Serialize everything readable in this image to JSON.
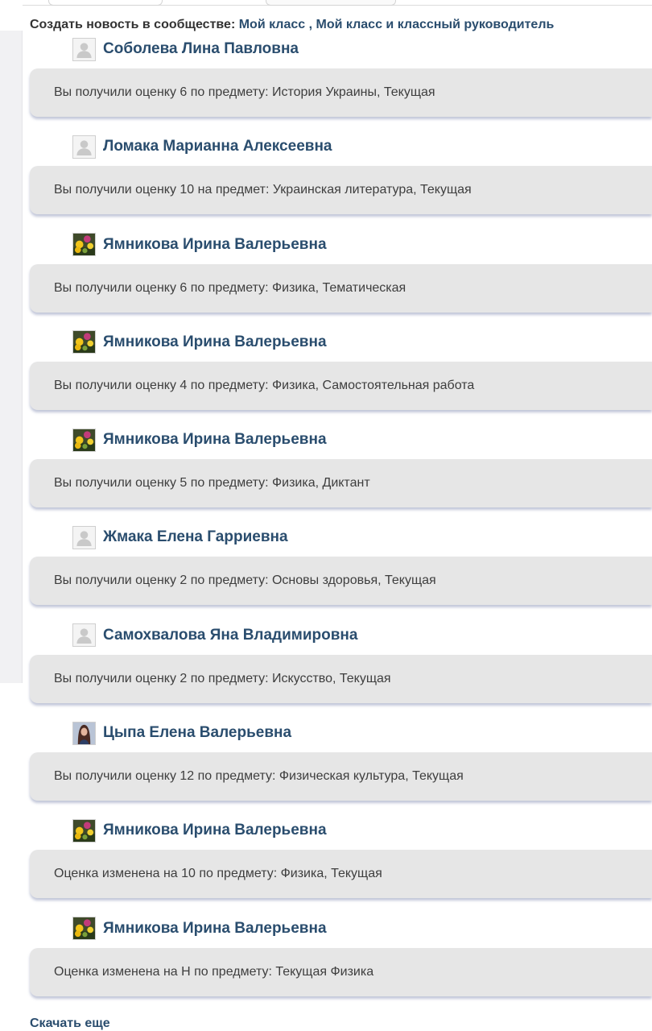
{
  "create_news": {
    "label": "Создать новость в сообществе:",
    "link1": "Мой класс",
    "separator": ",",
    "link2": "Мой класс и классный руководитель"
  },
  "feed": [
    {
      "author": "Соболева Лина Павловна",
      "avatar": "default-user-icon",
      "message": "Вы получили оценку 6 по предмету: История Украины, Текущая"
    },
    {
      "author": "Ломака Марианна Алексеевна",
      "avatar": "default-user-icon",
      "message": "Вы получили оценку 10 на предмет: Украинская литература, Текущая"
    },
    {
      "author": "Ямникова Ирина Валерьевна",
      "avatar": "photo-avatar-flowers",
      "message": "Вы получили оценку 6 по предмету: Физика, Тематическая"
    },
    {
      "author": "Ямникова Ирина Валерьевна",
      "avatar": "photo-avatar-flowers",
      "message": "Вы получили оценку 4 по предмету: Физика, Самостоятельная работа"
    },
    {
      "author": "Ямникова Ирина Валерьевна",
      "avatar": "photo-avatar-flowers",
      "message": "Вы получили оценку 5 по предмету: Физика, Диктант"
    },
    {
      "author": "Жмака Елена Гарриевна",
      "avatar": "default-user-icon",
      "message": "Вы получили оценку 2 по предмету: Основы здоровья, Текущая"
    },
    {
      "author": "Самохвалова Яна Владимировна",
      "avatar": "default-user-icon",
      "message": "Вы получили оценку 2 по предмету: Искусство, Текущая"
    },
    {
      "author": "Цыпа Елена Валерьевна",
      "avatar": "photo-avatar-portrait",
      "message": "Вы получили оценку 12 по предмету: Физическая культура, Текущая"
    },
    {
      "author": "Ямникова Ирина Валерьевна",
      "avatar": "photo-avatar-flowers",
      "message": "Оценка изменена на 10 по предмету: Физика, Текущая"
    },
    {
      "author": "Ямникова Ирина Валерьевна",
      "avatar": "photo-avatar-flowers",
      "message": "Оценка изменена на Н по предмету: Текущая Физика"
    }
  ],
  "load_more": "Скачать еще"
}
